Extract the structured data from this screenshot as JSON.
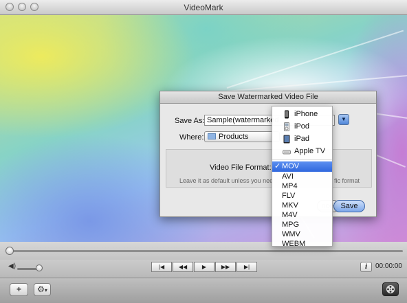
{
  "window": {
    "title": "VideoMark"
  },
  "dialog": {
    "title": "Save Watermarked Video File",
    "save_as_label": "Save As:",
    "save_as_value": "Sample(watermarked",
    "where_label": "Where:",
    "where_value": "Products",
    "format_label": "Video File Format:",
    "hint": "Leave it as default unless you nee",
    "hint_tail": "fic format",
    "cancel_label": "ncel",
    "save_label": "Save"
  },
  "format_menu": {
    "devices": [
      "iPhone",
      "iPod",
      "iPad",
      "Apple TV"
    ],
    "formats": [
      "MOV",
      "AVI",
      "MP4",
      "FLV",
      "MKV",
      "M4V",
      "MPG",
      "WMV",
      "WEBM"
    ],
    "selected": "MOV",
    "check": "✓"
  },
  "player": {
    "transport": [
      "|◀",
      "◀◀",
      "▶",
      "▶▶",
      "▶|"
    ],
    "time": "00:00:00",
    "info": "i"
  },
  "toolbar": {
    "add": "+",
    "gear_caret": "▾"
  }
}
